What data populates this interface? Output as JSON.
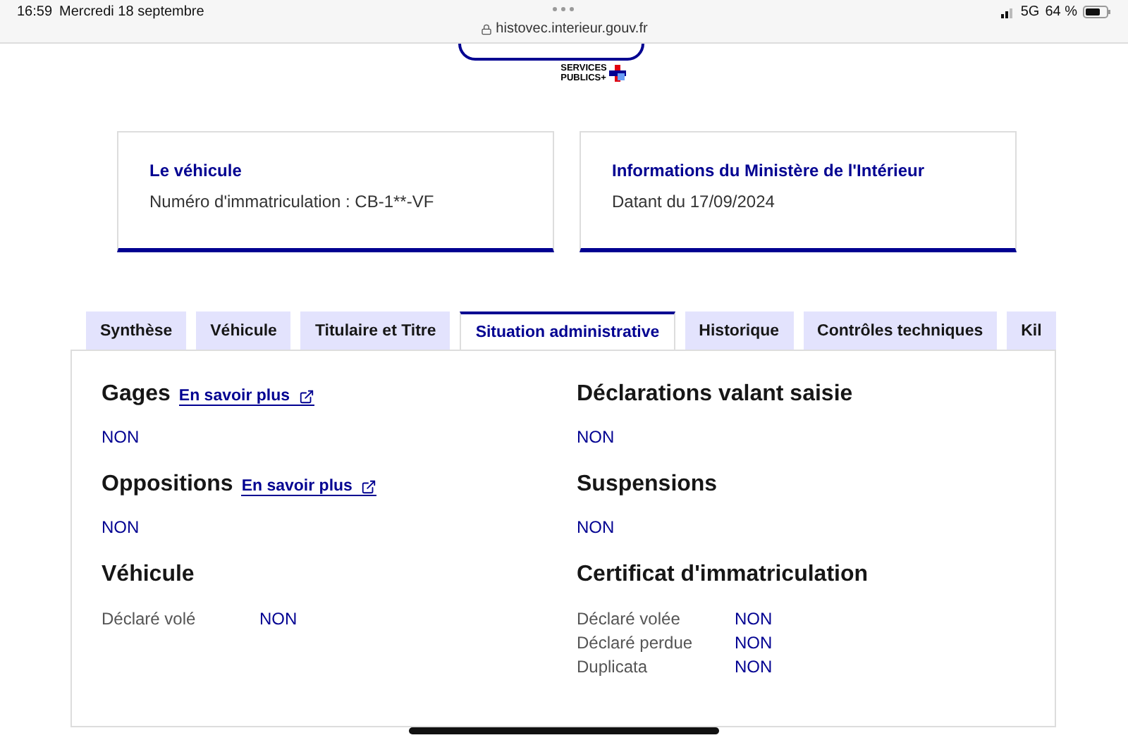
{
  "status_bar": {
    "time": "16:59",
    "date": "Mercredi 18 septembre",
    "url": "histovec.interieur.gouv.fr",
    "network": "5G",
    "battery": "64 %"
  },
  "header": {
    "logo_lines": [
      "SERVICES",
      "PUBLICS+"
    ]
  },
  "cards": [
    {
      "title": "Le véhicule",
      "text": "Numéro d'immatriculation : CB-1**-VF"
    },
    {
      "title": "Informations du Ministère de l'Intérieur",
      "text": "Datant du 17/09/2024"
    }
  ],
  "tabs": [
    {
      "label": "Synthèse",
      "selected": false
    },
    {
      "label": "Véhicule",
      "selected": false
    },
    {
      "label": "Titulaire et Titre",
      "selected": false
    },
    {
      "label": "Situation administrative",
      "selected": true
    },
    {
      "label": "Historique",
      "selected": false
    },
    {
      "label": "Contrôles techniques",
      "selected": false
    },
    {
      "label": "Kil",
      "selected": false
    }
  ],
  "columns": [
    [
      {
        "kind": "value",
        "title": "Gages",
        "link": "En savoir plus",
        "value": "NON"
      },
      {
        "kind": "value",
        "title": "Oppositions",
        "link": "En savoir plus",
        "value": "NON"
      },
      {
        "kind": "rows",
        "title": "Véhicule",
        "rows": [
          {
            "label": "Déclaré volé",
            "value": "NON"
          }
        ]
      }
    ],
    [
      {
        "kind": "value",
        "title": "Déclarations valant saisie",
        "value": "NON"
      },
      {
        "kind": "value",
        "title": "Suspensions",
        "value": "NON"
      },
      {
        "kind": "rows",
        "title": "Certificat d'immatriculation",
        "rows": [
          {
            "label": "Déclaré volée",
            "value": "NON"
          },
          {
            "label": "Déclaré perdue",
            "value": "NON"
          },
          {
            "label": "Duplicata",
            "value": "NON"
          }
        ]
      }
    ]
  ]
}
